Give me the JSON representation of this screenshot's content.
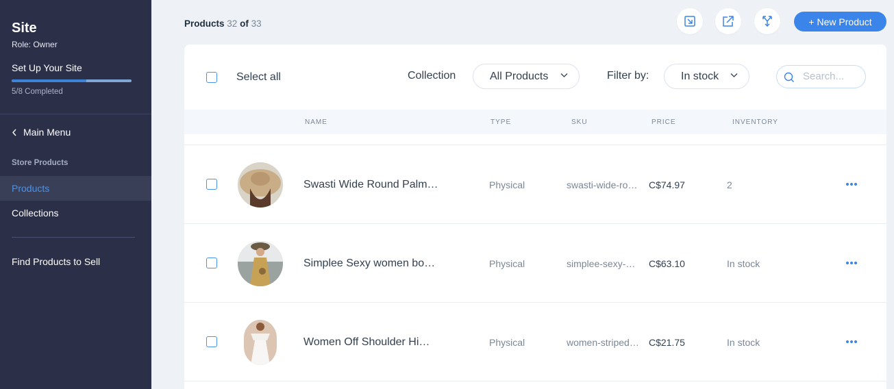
{
  "sidebar": {
    "site_title": "Site",
    "role": "Role: Owner",
    "setup_title": "Set Up Your Site",
    "progress_fraction": 0.625,
    "progress_text": "5/8 Completed",
    "main_menu": "Main Menu",
    "section_label": "Store Products",
    "items": [
      {
        "label": "Products",
        "active": true
      },
      {
        "label": "Collections",
        "active": false
      }
    ],
    "find_products": "Find Products to Sell"
  },
  "header": {
    "title": "Products",
    "count_shown": "32",
    "of": "of",
    "count_total": "33",
    "new_product_icon": "+",
    "new_product_label": "New Product",
    "icon_buttons": [
      "import-icon",
      "export-icon",
      "sync-icon"
    ]
  },
  "toolbar": {
    "select_all": "Select all",
    "collection_label": "Collection",
    "collection_value": "All Products",
    "filter_label": "Filter by:",
    "filter_value": "In stock",
    "search_placeholder": "Search..."
  },
  "table": {
    "columns": [
      "NAME",
      "TYPE",
      "SKU",
      "PRICE",
      "INVENTORY"
    ],
    "rows": [
      {
        "name": "Swasti Wide Round Palm…",
        "type": "Physical",
        "sku": "swasti-wide-ro…",
        "price": "C$74.97",
        "inventory": "2"
      },
      {
        "name": "Simplee Sexy women bo…",
        "type": "Physical",
        "sku": "simplee-sexy-…",
        "price": "C$63.10",
        "inventory": "In stock"
      },
      {
        "name": "Women Off Shoulder Hi…",
        "type": "Physical",
        "sku": "women-striped…",
        "price": "C$21.75",
        "inventory": "In stock"
      }
    ]
  },
  "colors": {
    "sidebar_bg": "#2b2f48",
    "accent": "#3b84ea",
    "page_bg": "#eef1f6"
  }
}
